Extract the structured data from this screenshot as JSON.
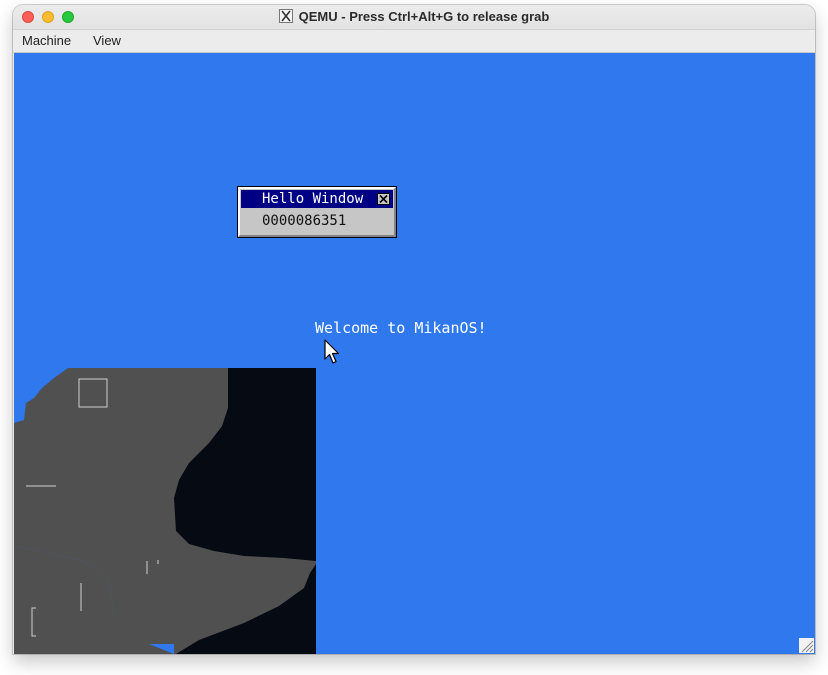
{
  "window": {
    "title": "QEMU - Press Ctrl+Alt+G to release grab"
  },
  "menubar": {
    "items": [
      {
        "label": "Machine"
      },
      {
        "label": "View"
      }
    ]
  },
  "guest_screen": {
    "background_color": "#2f78ee",
    "hello_window": {
      "title": "Hello Window",
      "counter": "0000086351",
      "close_icon": "close-icon"
    },
    "welcome_text": "Welcome to MikanOS!",
    "cursor_icon": "mouse-pointer-icon"
  }
}
